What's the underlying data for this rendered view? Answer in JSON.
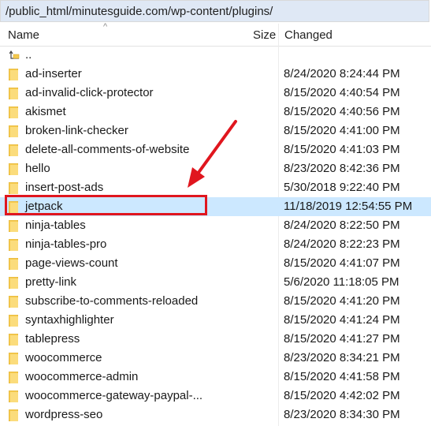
{
  "path": "/public_html/minutesguide.com/wp-content/plugins/",
  "columns": {
    "name": "Name",
    "size": "Size",
    "changed": "Changed"
  },
  "sort": {
    "column": "name",
    "indicator": "^"
  },
  "parent": {
    "label": ".."
  },
  "rows": [
    {
      "name": "ad-inserter",
      "changed": "8/24/2020 8:24:44 PM"
    },
    {
      "name": "ad-invalid-click-protector",
      "changed": "8/15/2020 4:40:54 PM"
    },
    {
      "name": "akismet",
      "changed": "8/15/2020 4:40:56 PM"
    },
    {
      "name": "broken-link-checker",
      "changed": "8/15/2020 4:41:00 PM"
    },
    {
      "name": "delete-all-comments-of-website",
      "changed": "8/15/2020 4:41:03 PM"
    },
    {
      "name": "hello",
      "changed": "8/23/2020 8:42:36 PM"
    },
    {
      "name": "insert-post-ads",
      "changed": "5/30/2018 9:22:40 PM"
    },
    {
      "name": "jetpack",
      "changed": "11/18/2019 12:54:55 PM",
      "selected": true
    },
    {
      "name": "ninja-tables",
      "changed": "8/24/2020 8:22:50 PM"
    },
    {
      "name": "ninja-tables-pro",
      "changed": "8/24/2020 8:22:23 PM"
    },
    {
      "name": "page-views-count",
      "changed": "8/15/2020 4:41:07 PM"
    },
    {
      "name": "pretty-link",
      "changed": "5/6/2020 11:18:05 PM"
    },
    {
      "name": "subscribe-to-comments-reloaded",
      "changed": "8/15/2020 4:41:20 PM"
    },
    {
      "name": "syntaxhighlighter",
      "changed": "8/15/2020 4:41:24 PM"
    },
    {
      "name": "tablepress",
      "changed": "8/15/2020 4:41:27 PM"
    },
    {
      "name": "woocommerce",
      "changed": "8/23/2020 8:34:21 PM"
    },
    {
      "name": "woocommerce-admin",
      "changed": "8/15/2020 4:41:58 PM"
    },
    {
      "name": "woocommerce-gateway-paypal-...",
      "changed": "8/15/2020 4:42:02 PM"
    },
    {
      "name": "wordpress-seo",
      "changed": "8/23/2020 8:34:30 PM"
    }
  ],
  "icons": {
    "folder": "folder-icon",
    "parent": "parent-folder-icon",
    "annotation": "red-arrow-icon"
  },
  "colors": {
    "path_bar_bg": "#dfe8f5",
    "selection_bg": "#cce8ff",
    "folder_yellow": "#f5c94e",
    "annotation_red": "#e0161e"
  }
}
